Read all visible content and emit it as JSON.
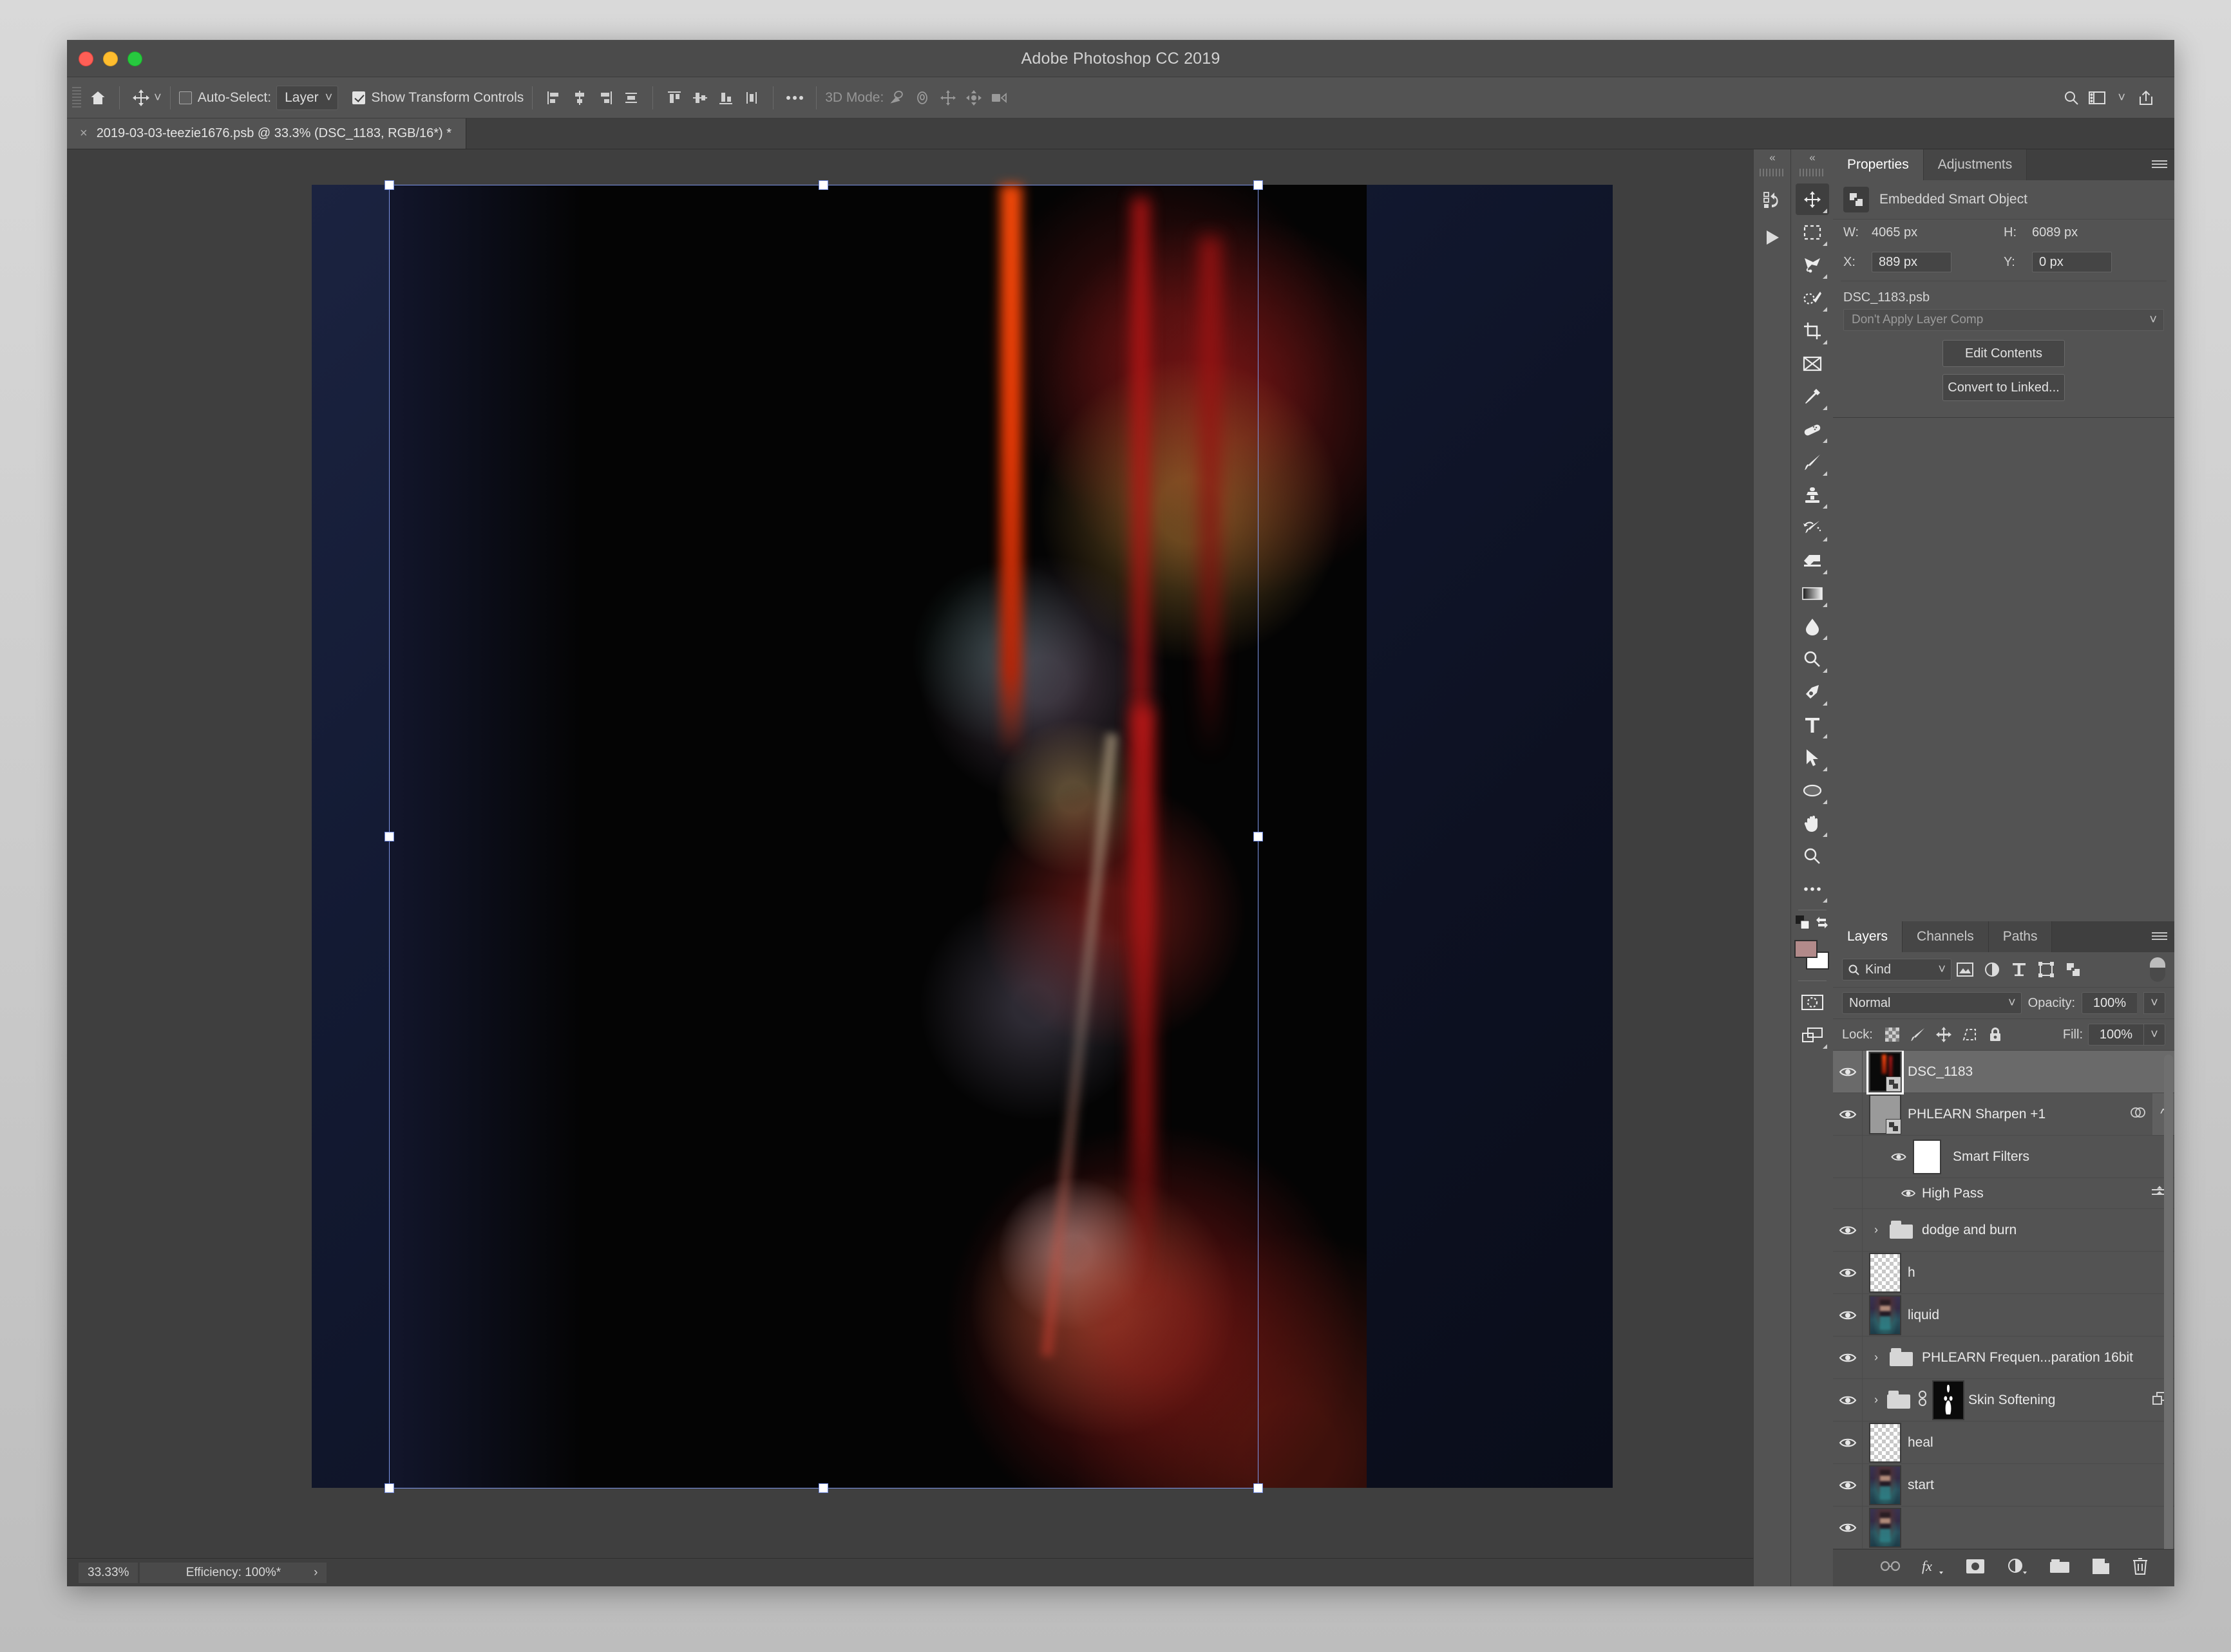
{
  "window": {
    "app_title": "Adobe Photoshop CC 2019"
  },
  "options_bar": {
    "home_icon": "home-icon",
    "tool_icon": "move-tool-icon",
    "auto_select_label": "Auto-Select:",
    "auto_select_checked": false,
    "auto_select_value": "Layer",
    "show_transform_label": "Show Transform Controls",
    "show_transform_checked": true,
    "align_icons": [
      "align-left-edges-icon",
      "align-horizontal-centers-icon",
      "align-right-edges-icon",
      "distribute-horizontal-icon"
    ],
    "distribute_icons": [
      "align-top-edges-icon",
      "align-vertical-centers-icon",
      "align-bottom-edges-icon",
      "distribute-vertical-icon"
    ],
    "more_icon": "ellipsis-icon",
    "threed_label": "3D Mode:",
    "threed_icons": [
      "3d-rotate-icon",
      "3d-roll-icon",
      "3d-pan-icon",
      "3d-slide-icon",
      "3d-scale-camera-icon"
    ],
    "right_icons": [
      "search-icon",
      "workspace-icon",
      "chevron-down-icon",
      "share-icon"
    ]
  },
  "document_tab": {
    "close_glyph": "×",
    "title": "2019-03-03-teezie1676.psb @ 33.3% (DSC_1183, RGB/16*) *"
  },
  "status_bar": {
    "zoom": "33.33%",
    "efficiency": "Efficiency: 100%*",
    "arrow": "›"
  },
  "toolbar": {
    "collapse_glyph": "«",
    "tools": [
      {
        "name": "move-tool",
        "icon": "move-tool-icon",
        "active": true,
        "has_flyout": true
      },
      {
        "name": "rectangular-marquee-tool",
        "icon": "marquee-icon",
        "active": false,
        "has_flyout": true
      },
      {
        "name": "lasso-tool",
        "icon": "lasso-icon",
        "active": false,
        "has_flyout": true
      },
      {
        "name": "quick-selection-tool",
        "icon": "quick-select-icon",
        "active": false,
        "has_flyout": true
      },
      {
        "name": "crop-tool",
        "icon": "crop-icon",
        "active": false,
        "has_flyout": true
      },
      {
        "name": "frame-tool",
        "icon": "frame-icon",
        "active": false,
        "has_flyout": false
      },
      {
        "name": "eyedropper-tool",
        "icon": "eyedropper-icon",
        "active": false,
        "has_flyout": true
      },
      {
        "name": "healing-brush-tool",
        "icon": "bandage-icon",
        "active": false,
        "has_flyout": true
      },
      {
        "name": "brush-tool",
        "icon": "brush-icon",
        "active": false,
        "has_flyout": true
      },
      {
        "name": "clone-stamp-tool",
        "icon": "stamp-icon",
        "active": false,
        "has_flyout": true
      },
      {
        "name": "history-brush-tool",
        "icon": "history-brush-icon",
        "active": false,
        "has_flyout": true
      },
      {
        "name": "eraser-tool",
        "icon": "eraser-icon",
        "active": false,
        "has_flyout": true
      },
      {
        "name": "gradient-tool",
        "icon": "gradient-icon",
        "active": false,
        "has_flyout": true
      },
      {
        "name": "blur-tool",
        "icon": "blur-drop-icon",
        "active": false,
        "has_flyout": true
      },
      {
        "name": "dodge-tool",
        "icon": "dodge-icon",
        "active": false,
        "has_flyout": true
      },
      {
        "name": "pen-tool",
        "icon": "pen-icon",
        "active": false,
        "has_flyout": true
      },
      {
        "name": "type-tool",
        "icon": "type-t-icon",
        "active": false,
        "has_flyout": true
      },
      {
        "name": "path-selection-tool",
        "icon": "path-arrow-icon",
        "active": false,
        "has_flyout": true
      },
      {
        "name": "ellipse-tool",
        "icon": "ellipse-icon",
        "active": false,
        "has_flyout": true
      },
      {
        "name": "hand-tool",
        "icon": "hand-icon",
        "active": false,
        "has_flyout": true
      },
      {
        "name": "zoom-tool",
        "icon": "magnifier-icon",
        "active": false,
        "has_flyout": false
      },
      {
        "name": "edit-toolbar",
        "icon": "ellipsis-icon",
        "active": false,
        "has_flyout": true
      }
    ],
    "foreground_color": "#b28a8a",
    "background_color": "#ffffff",
    "quick_mask_icon": "quick-mask-icon",
    "screen_mode_icon": "screen-mode-icon",
    "swap_colors_icon": "swap-colors-icon",
    "default_colors_icon": "default-colors-icon"
  },
  "history_col": {
    "collapse_glyph": "«",
    "icons": [
      "history-icon",
      "actions-play-icon"
    ]
  },
  "properties_panel": {
    "tabs": [
      {
        "label": "Properties",
        "active": true
      },
      {
        "label": "Adjustments",
        "active": false
      }
    ],
    "menu_icon": "panel-menu-icon",
    "object_type_icon": "smart-object-icon",
    "object_type": "Embedded Smart Object",
    "w_label": "W:",
    "w_value": "4065 px",
    "h_label": "H:",
    "h_value": "6089 px",
    "x_label": "X:",
    "x_value": "889 px",
    "y_label": "Y:",
    "y_value": "0 px",
    "filename": "DSC_1183.psb",
    "layer_comp": "Don't Apply Layer Comp",
    "edit_contents_label": "Edit Contents",
    "convert_to_linked_label": "Convert to Linked..."
  },
  "layers_panel": {
    "tabs": [
      {
        "label": "Layers",
        "active": true
      },
      {
        "label": "Channels",
        "active": false
      },
      {
        "label": "Paths",
        "active": false
      }
    ],
    "menu_icon": "panel-menu-icon",
    "filter_kind": "Kind",
    "filter_icons": [
      "filter-pixel-icon",
      "filter-adjustment-icon",
      "filter-type-icon",
      "filter-shape-icon",
      "filter-smart-object-icon"
    ],
    "filter_toggle": "filter-enable-toggle",
    "blend_mode": "Normal",
    "opacity_label": "Opacity:",
    "opacity_value": "100%",
    "lock_label": "Lock:",
    "lock_icons": [
      "lock-transparency-icon",
      "lock-image-icon",
      "lock-position-icon",
      "lock-artboard-icon",
      "lock-all-icon"
    ],
    "fill_label": "Fill:",
    "fill_value": "100%",
    "rows": [
      {
        "name": "DSC_1183",
        "kind": "smart-object",
        "thumb": "dscphoto",
        "selected": true,
        "indent": 0,
        "visible": true,
        "disclosure": null,
        "right_icons": []
      },
      {
        "name": "PHLEARN Sharpen +1",
        "kind": "smart-object",
        "thumb": "gray",
        "selected": false,
        "indent": 0,
        "visible": true,
        "disclosure": null,
        "right_icons": [
          "smart-filter-icon",
          "chevron-up-icon"
        ]
      },
      {
        "name": "Smart Filters",
        "kind": "smart-filters",
        "thumb": "white",
        "selected": false,
        "indent": 1,
        "visible": true,
        "disclosure": null,
        "right_icons": []
      },
      {
        "name": "High Pass",
        "kind": "filter",
        "thumb": null,
        "selected": false,
        "indent": 2,
        "visible": true,
        "disclosure": null,
        "right_icons": [
          "filter-options-icon"
        ]
      },
      {
        "name": "dodge and burn",
        "kind": "group",
        "thumb": "folder",
        "selected": false,
        "indent": 0,
        "visible": true,
        "disclosure": "›",
        "right_icons": []
      },
      {
        "name": "h",
        "kind": "pixel",
        "thumb": "checker",
        "selected": false,
        "indent": 0,
        "visible": true,
        "disclosure": null,
        "right_icons": []
      },
      {
        "name": "liquid",
        "kind": "pixel",
        "thumb": "photo",
        "selected": false,
        "indent": 0,
        "visible": true,
        "disclosure": null,
        "right_icons": []
      },
      {
        "name": "PHLEARN Frequen...paration 16bit",
        "kind": "group",
        "thumb": "folder",
        "selected": false,
        "indent": 0,
        "visible": true,
        "disclosure": "›",
        "right_icons": []
      },
      {
        "name": "Skin Softening",
        "kind": "group-masked",
        "thumb": "mask-blk",
        "selected": false,
        "indent": 0,
        "visible": true,
        "disclosure": "›",
        "right_icons": [
          "clipping-icon"
        ]
      },
      {
        "name": "heal",
        "kind": "pixel",
        "thumb": "checker",
        "selected": false,
        "indent": 0,
        "visible": true,
        "disclosure": null,
        "right_icons": []
      },
      {
        "name": "start",
        "kind": "pixel",
        "thumb": "photo",
        "selected": false,
        "indent": 0,
        "visible": true,
        "disclosure": null,
        "right_icons": []
      },
      {
        "name": "",
        "kind": "pixel",
        "thumb": "photo",
        "selected": false,
        "indent": 0,
        "visible": true,
        "disclosure": null,
        "right_icons": []
      }
    ],
    "bottom_icons": [
      "link-layers-icon",
      "fx-icon",
      "add-mask-icon",
      "adjustment-layer-icon",
      "new-group-icon",
      "new-layer-icon",
      "delete-layer-icon"
    ]
  },
  "canvas": {
    "zoom_percent": "33.33%",
    "selection_handles": 8
  }
}
